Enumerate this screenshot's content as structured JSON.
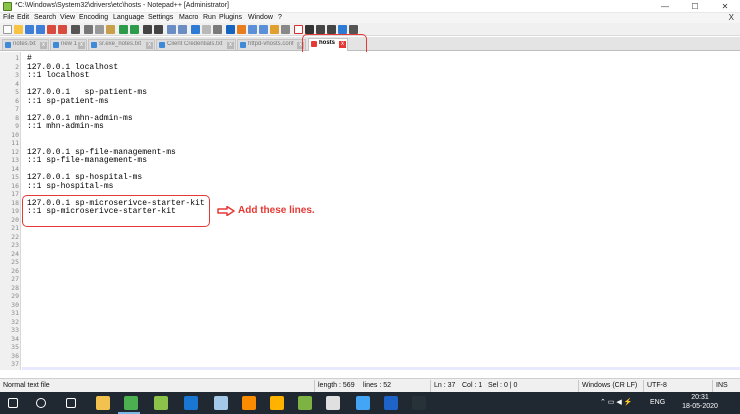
{
  "window": {
    "title": "*C:\\Windows\\System32\\drivers\\etc\\hosts - Notepad++ [Administrator]",
    "controls": {
      "minimize": "—",
      "maximize": "☐",
      "close": "✕"
    }
  },
  "menu": {
    "items": [
      "File",
      "Edit",
      "Search",
      "View",
      "Encoding",
      "Language",
      "Settings",
      "Macro",
      "Run",
      "Plugins",
      "Window",
      "?"
    ],
    "close_glyph": "X"
  },
  "tabs": [
    {
      "label": "notes.txt",
      "active": false
    },
    {
      "label": "new 1",
      "active": false
    },
    {
      "label": "sr.exe_notes.txt",
      "active": false
    },
    {
      "label": "Client Credentials.txt",
      "active": false
    },
    {
      "label": "httpd-vhosts.conf",
      "active": false
    },
    {
      "label": "hosts",
      "active": true
    }
  ],
  "editor": {
    "lines": [
      {
        "n": "1",
        "text": "#"
      },
      {
        "n": "2",
        "text": "127.0.0.1 localhost"
      },
      {
        "n": "3",
        "text": "::1 localhost"
      },
      {
        "n": "4",
        "text": ""
      },
      {
        "n": "5",
        "text": "127.0.0.1   sp-patient-ms"
      },
      {
        "n": "6",
        "text": "::1 sp-patient-ms"
      },
      {
        "n": "7",
        "text": ""
      },
      {
        "n": "8",
        "text": "127.0.0.1 mhn-admin-ms"
      },
      {
        "n": "9",
        "text": "::1 mhn-admin-ms"
      },
      {
        "n": "10",
        "text": ""
      },
      {
        "n": "11",
        "text": ""
      },
      {
        "n": "12",
        "text": "127.0.0.1 sp-file-management-ms"
      },
      {
        "n": "13",
        "text": "::1 sp-file-management-ms"
      },
      {
        "n": "14",
        "text": ""
      },
      {
        "n": "15",
        "text": "127.0.0.1 sp-hospital-ms"
      },
      {
        "n": "16",
        "text": "::1 sp-hospital-ms"
      },
      {
        "n": "17",
        "text": ""
      },
      {
        "n": "18",
        "text": "127.0.0.1 sp-microserivce-starter-kit"
      },
      {
        "n": "19",
        "text": "::1 sp-microserivce-starter-kit"
      },
      {
        "n": "20",
        "text": ""
      },
      {
        "n": "21",
        "text": ""
      },
      {
        "n": "22",
        "text": ""
      },
      {
        "n": "23",
        "text": ""
      },
      {
        "n": "24",
        "text": ""
      },
      {
        "n": "25",
        "text": ""
      },
      {
        "n": "26",
        "text": ""
      },
      {
        "n": "27",
        "text": ""
      },
      {
        "n": "28",
        "text": ""
      },
      {
        "n": "29",
        "text": ""
      },
      {
        "n": "30",
        "text": ""
      },
      {
        "n": "31",
        "text": ""
      },
      {
        "n": "32",
        "text": ""
      },
      {
        "n": "33",
        "text": ""
      },
      {
        "n": "34",
        "text": ""
      },
      {
        "n": "35",
        "text": ""
      },
      {
        "n": "36",
        "text": ""
      },
      {
        "n": "37",
        "text": ""
      }
    ]
  },
  "annotation": {
    "text": "Add these lines.",
    "color": "#e53935"
  },
  "status": {
    "file_type": "Normal text file",
    "length": "length : 569",
    "lines": "lines : 52",
    "ln": "Ln : 37",
    "col": "Col : 1",
    "sel": "Sel : 0 | 0",
    "eol": "Windows (CR LF)",
    "encoding": "UTF-8",
    "mode": "INS"
  },
  "taskbar": {
    "search_glyph": "⌕",
    "tray_glyphs": "⌃ ▭ ◀ ⚡",
    "language": "ENG",
    "time": "20:31",
    "date": "18-05-2020",
    "icons": [
      {
        "name": "windows-start-icon",
        "color": "#ffffff"
      },
      {
        "name": "search-icon",
        "color": "#ffffff"
      },
      {
        "name": "task-view-icon",
        "color": "#ffffff"
      },
      {
        "name": "file-explorer-icon",
        "color": "#f2c14e"
      },
      {
        "name": "chrome-icon",
        "color": "#4caf50"
      },
      {
        "name": "notepad-plus-plus-icon",
        "color": "#8bc34a"
      },
      {
        "name": "maps-icon",
        "color": "#1976d2"
      },
      {
        "name": "sticky-notes-icon",
        "color": "#a4c9e8"
      },
      {
        "name": "xampp-icon",
        "color": "#fb8c00"
      },
      {
        "name": "paint-icon",
        "color": "#ffb300"
      },
      {
        "name": "app-icon-green",
        "color": "#7cb342"
      },
      {
        "name": "app-icon-camera",
        "color": "#e0e0e0"
      },
      {
        "name": "app-icon-blue",
        "color": "#42a5f5"
      },
      {
        "name": "word-icon",
        "color": "#1e64c8"
      },
      {
        "name": "app-icon-dark",
        "color": "#263238"
      }
    ]
  }
}
